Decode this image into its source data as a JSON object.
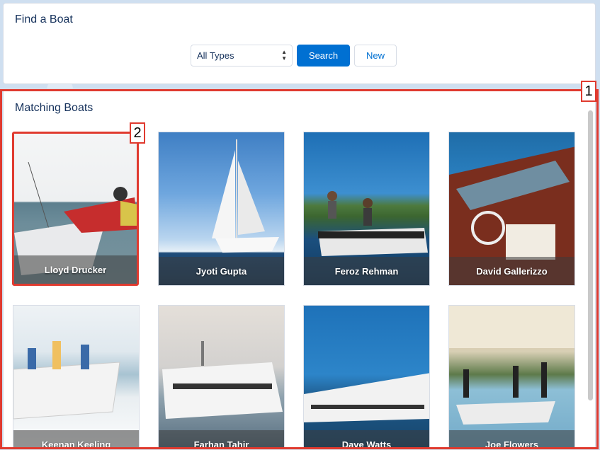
{
  "find": {
    "title": "Find a Boat",
    "type_select": "All Types",
    "search_label": "Search",
    "new_label": "New"
  },
  "matching": {
    "title": "Matching Boats",
    "boats": [
      {
        "owner": "Lloyd Drucker"
      },
      {
        "owner": "Jyoti Gupta"
      },
      {
        "owner": "Feroz Rehman"
      },
      {
        "owner": "David Gallerizzo"
      },
      {
        "owner": "Keenan Keeling"
      },
      {
        "owner": "Farhan Tahir"
      },
      {
        "owner": "Dave Watts"
      },
      {
        "owner": "Joe Flowers"
      }
    ]
  },
  "callouts": {
    "one": "1",
    "two": "2"
  },
  "colors": {
    "accent": "#0070d2",
    "highlight": "#e03a2f"
  }
}
